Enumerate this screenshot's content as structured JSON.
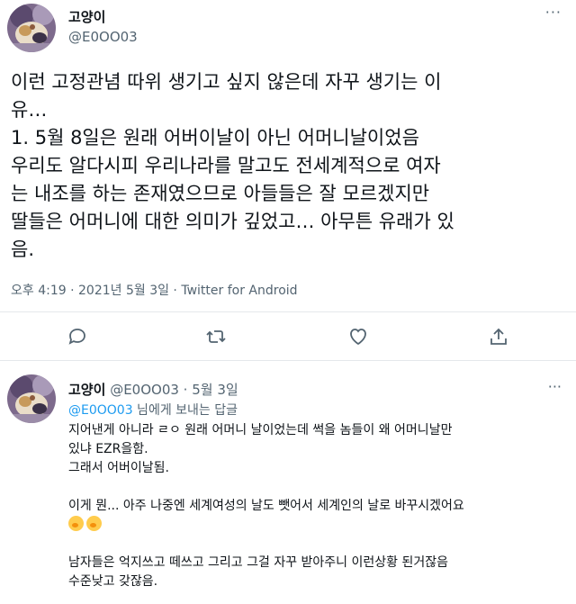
{
  "tweet": {
    "name": "고양이",
    "handle": "@E0OO03",
    "more": "···",
    "lines": [
      "이런 고정관념 따위 생기고 싶지 않은데 자꾸 생기는 이",
      "유…",
      "1. 5월 8일은 원래 어버이날이 아닌 어머니날이었음",
      "우리도 알다시피 우리나라를 말고도 전세계적으로 여자",
      "는 내조를 하는 존재였으므로 아들들은 잘 모르겠지만",
      "딸들은 어머니에 대한 의미가 깊었고… 아무튼 유래가 있",
      "음."
    ],
    "meta": "오후 4:19 · 2021년 5월 3일 · Twitter for Android"
  },
  "actions": [
    {
      "icon": "reply-icon"
    },
    {
      "icon": "retweet-icon"
    },
    {
      "icon": "like-icon"
    },
    {
      "icon": "share-icon"
    }
  ],
  "reply": {
    "name": "고양이",
    "handle_date": "@E0OO03 · 5월 3일",
    "more": "···",
    "to_handle": "@E0OO03",
    "to_suffix": " 님에게 보내는 답글",
    "lines": [
      "지어낸게 아니라 ㄹㅇ 원래 어머니 날이었는데 썩을 놈들이 왜 어머니날만",
      "있냐 EZR을함.",
      "그래서 어버이날됨.",
      "",
      "이게 뭔... 아주 나중엔 세계여성의 날도 뺏어서 세계인의 날로 바꾸시겠어요",
      "",
      "",
      "남자들은 억지쓰고 떼쓰고 그리고 그걸 자꾸 받아주니 이런상황 된거잖음",
      "수준낮고 갖잖음."
    ]
  }
}
